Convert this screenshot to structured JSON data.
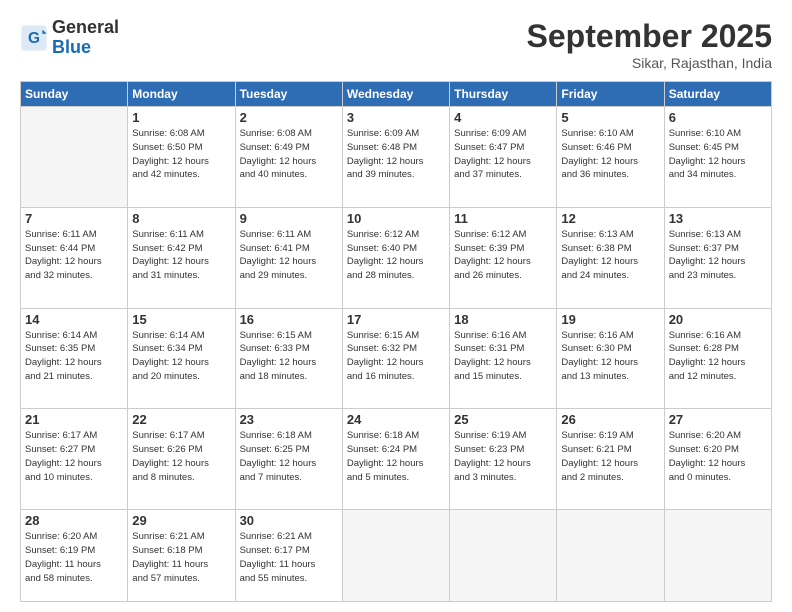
{
  "logo": {
    "general": "General",
    "blue": "Blue"
  },
  "header": {
    "month": "September 2025",
    "location": "Sikar, Rajasthan, India"
  },
  "days_of_week": [
    "Sunday",
    "Monday",
    "Tuesday",
    "Wednesday",
    "Thursday",
    "Friday",
    "Saturday"
  ],
  "weeks": [
    [
      {
        "day": "",
        "info": ""
      },
      {
        "day": "1",
        "info": "Sunrise: 6:08 AM\nSunset: 6:50 PM\nDaylight: 12 hours\nand 42 minutes."
      },
      {
        "day": "2",
        "info": "Sunrise: 6:08 AM\nSunset: 6:49 PM\nDaylight: 12 hours\nand 40 minutes."
      },
      {
        "day": "3",
        "info": "Sunrise: 6:09 AM\nSunset: 6:48 PM\nDaylight: 12 hours\nand 39 minutes."
      },
      {
        "day": "4",
        "info": "Sunrise: 6:09 AM\nSunset: 6:47 PM\nDaylight: 12 hours\nand 37 minutes."
      },
      {
        "day": "5",
        "info": "Sunrise: 6:10 AM\nSunset: 6:46 PM\nDaylight: 12 hours\nand 36 minutes."
      },
      {
        "day": "6",
        "info": "Sunrise: 6:10 AM\nSunset: 6:45 PM\nDaylight: 12 hours\nand 34 minutes."
      }
    ],
    [
      {
        "day": "7",
        "info": "Sunrise: 6:11 AM\nSunset: 6:44 PM\nDaylight: 12 hours\nand 32 minutes."
      },
      {
        "day": "8",
        "info": "Sunrise: 6:11 AM\nSunset: 6:42 PM\nDaylight: 12 hours\nand 31 minutes."
      },
      {
        "day": "9",
        "info": "Sunrise: 6:11 AM\nSunset: 6:41 PM\nDaylight: 12 hours\nand 29 minutes."
      },
      {
        "day": "10",
        "info": "Sunrise: 6:12 AM\nSunset: 6:40 PM\nDaylight: 12 hours\nand 28 minutes."
      },
      {
        "day": "11",
        "info": "Sunrise: 6:12 AM\nSunset: 6:39 PM\nDaylight: 12 hours\nand 26 minutes."
      },
      {
        "day": "12",
        "info": "Sunrise: 6:13 AM\nSunset: 6:38 PM\nDaylight: 12 hours\nand 24 minutes."
      },
      {
        "day": "13",
        "info": "Sunrise: 6:13 AM\nSunset: 6:37 PM\nDaylight: 12 hours\nand 23 minutes."
      }
    ],
    [
      {
        "day": "14",
        "info": "Sunrise: 6:14 AM\nSunset: 6:35 PM\nDaylight: 12 hours\nand 21 minutes."
      },
      {
        "day": "15",
        "info": "Sunrise: 6:14 AM\nSunset: 6:34 PM\nDaylight: 12 hours\nand 20 minutes."
      },
      {
        "day": "16",
        "info": "Sunrise: 6:15 AM\nSunset: 6:33 PM\nDaylight: 12 hours\nand 18 minutes."
      },
      {
        "day": "17",
        "info": "Sunrise: 6:15 AM\nSunset: 6:32 PM\nDaylight: 12 hours\nand 16 minutes."
      },
      {
        "day": "18",
        "info": "Sunrise: 6:16 AM\nSunset: 6:31 PM\nDaylight: 12 hours\nand 15 minutes."
      },
      {
        "day": "19",
        "info": "Sunrise: 6:16 AM\nSunset: 6:30 PM\nDaylight: 12 hours\nand 13 minutes."
      },
      {
        "day": "20",
        "info": "Sunrise: 6:16 AM\nSunset: 6:28 PM\nDaylight: 12 hours\nand 12 minutes."
      }
    ],
    [
      {
        "day": "21",
        "info": "Sunrise: 6:17 AM\nSunset: 6:27 PM\nDaylight: 12 hours\nand 10 minutes."
      },
      {
        "day": "22",
        "info": "Sunrise: 6:17 AM\nSunset: 6:26 PM\nDaylight: 12 hours\nand 8 minutes."
      },
      {
        "day": "23",
        "info": "Sunrise: 6:18 AM\nSunset: 6:25 PM\nDaylight: 12 hours\nand 7 minutes."
      },
      {
        "day": "24",
        "info": "Sunrise: 6:18 AM\nSunset: 6:24 PM\nDaylight: 12 hours\nand 5 minutes."
      },
      {
        "day": "25",
        "info": "Sunrise: 6:19 AM\nSunset: 6:23 PM\nDaylight: 12 hours\nand 3 minutes."
      },
      {
        "day": "26",
        "info": "Sunrise: 6:19 AM\nSunset: 6:21 PM\nDaylight: 12 hours\nand 2 minutes."
      },
      {
        "day": "27",
        "info": "Sunrise: 6:20 AM\nSunset: 6:20 PM\nDaylight: 12 hours\nand 0 minutes."
      }
    ],
    [
      {
        "day": "28",
        "info": "Sunrise: 6:20 AM\nSunset: 6:19 PM\nDaylight: 11 hours\nand 58 minutes."
      },
      {
        "day": "29",
        "info": "Sunrise: 6:21 AM\nSunset: 6:18 PM\nDaylight: 11 hours\nand 57 minutes."
      },
      {
        "day": "30",
        "info": "Sunrise: 6:21 AM\nSunset: 6:17 PM\nDaylight: 11 hours\nand 55 minutes."
      },
      {
        "day": "",
        "info": ""
      },
      {
        "day": "",
        "info": ""
      },
      {
        "day": "",
        "info": ""
      },
      {
        "day": "",
        "info": ""
      }
    ]
  ]
}
